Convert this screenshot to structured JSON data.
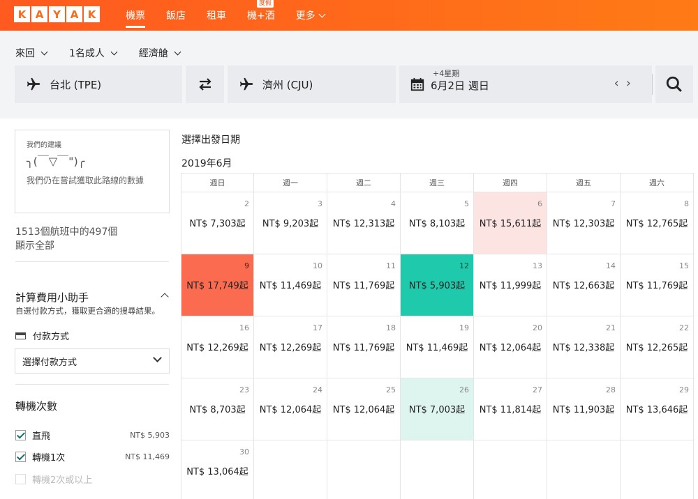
{
  "header": {
    "logo_letters": [
      "K",
      "A",
      "Y",
      "A",
      "K"
    ],
    "nav": [
      {
        "label": "機票",
        "active": true
      },
      {
        "label": "飯店"
      },
      {
        "label": "租車"
      },
      {
        "label": "機+酒",
        "badge": "度假"
      },
      {
        "label": "更多"
      }
    ],
    "brand_color": "#ff6a1a"
  },
  "search": {
    "trip_type": "來回",
    "travelers": "1名成人",
    "cabin": "經濟艙",
    "origin": "台北 (TPE)",
    "destination": "濟州 (CJU)",
    "date_sub": "+4星期",
    "date": "6月2日 週日",
    "date_prev": "‹",
    "date_next": "›"
  },
  "sidebar": {
    "suggest_label": "我們的建議",
    "suggest_face": "╮(￣▽￣\")╭",
    "suggest_text": "我們仍在嘗試獲取此路線的數據",
    "flight_count": "1513個航班中的497個",
    "show_all": "顯示全部",
    "calc_title": "計算費用小助手",
    "calc_desc": "自選付款方式，獲取更合適的搜尋結果。",
    "pay_label": "付款方式",
    "pay_select": "選擇付款方式",
    "stops_title": "轉機次數",
    "stops": [
      {
        "label": "直飛",
        "price": "NT$ 5,903",
        "checked": true
      },
      {
        "label": "轉機1次",
        "price": "NT$ 11,469",
        "checked": true
      },
      {
        "label": "轉機2次或以上",
        "price": "",
        "checked": false
      }
    ]
  },
  "calendar": {
    "title": "選擇出發日期",
    "month": "2019年6月",
    "weekdays": [
      "週日",
      "週一",
      "週二",
      "週三",
      "週四",
      "週五",
      "週六"
    ],
    "weeks": [
      [
        {
          "day": "2",
          "price": "NT$ 7,303起"
        },
        {
          "day": "3",
          "price": "NT$ 9,203起"
        },
        {
          "day": "4",
          "price": "NT$ 12,313起"
        },
        {
          "day": "5",
          "price": "NT$ 8,103起"
        },
        {
          "day": "6",
          "price": "NT$ 15,611起",
          "style": "expensive"
        },
        {
          "day": "7",
          "price": "NT$ 12,303起"
        },
        {
          "day": "8",
          "price": "NT$ 12,765起"
        }
      ],
      [
        {
          "day": "9",
          "price": "NT$ 17,749起",
          "style": "red"
        },
        {
          "day": "10",
          "price": "NT$ 11,469起"
        },
        {
          "day": "11",
          "price": "NT$ 11,769起"
        },
        {
          "day": "12",
          "price": "NT$ 5,903起",
          "style": "green"
        },
        {
          "day": "13",
          "price": "NT$ 11,999起"
        },
        {
          "day": "14",
          "price": "NT$ 12,663起"
        },
        {
          "day": "15",
          "price": "NT$ 11,769起"
        }
      ],
      [
        {
          "day": "16",
          "price": "NT$ 12,269起"
        },
        {
          "day": "17",
          "price": "NT$ 12,269起"
        },
        {
          "day": "18",
          "price": "NT$ 11,769起"
        },
        {
          "day": "19",
          "price": "NT$ 11,469起"
        },
        {
          "day": "20",
          "price": "NT$ 12,064起"
        },
        {
          "day": "21",
          "price": "NT$ 12,338起"
        },
        {
          "day": "22",
          "price": "NT$ 12,265起"
        }
      ],
      [
        {
          "day": "23",
          "price": "NT$ 8,703起"
        },
        {
          "day": "24",
          "price": "NT$ 12,064起"
        },
        {
          "day": "25",
          "price": "NT$ 12,064起"
        },
        {
          "day": "26",
          "price": "NT$ 7,003起",
          "style": "lightgreen"
        },
        {
          "day": "27",
          "price": "NT$ 11,814起"
        },
        {
          "day": "28",
          "price": "NT$ 11,903起"
        },
        {
          "day": "29",
          "price": "NT$ 13,646起"
        }
      ],
      [
        {
          "day": "30",
          "price": "NT$ 13,064起"
        },
        {
          "day": "",
          "price": ""
        },
        {
          "day": "",
          "price": ""
        },
        {
          "day": "",
          "price": ""
        },
        {
          "day": "",
          "price": ""
        },
        {
          "day": "",
          "price": ""
        },
        {
          "day": "",
          "price": ""
        }
      ]
    ]
  }
}
